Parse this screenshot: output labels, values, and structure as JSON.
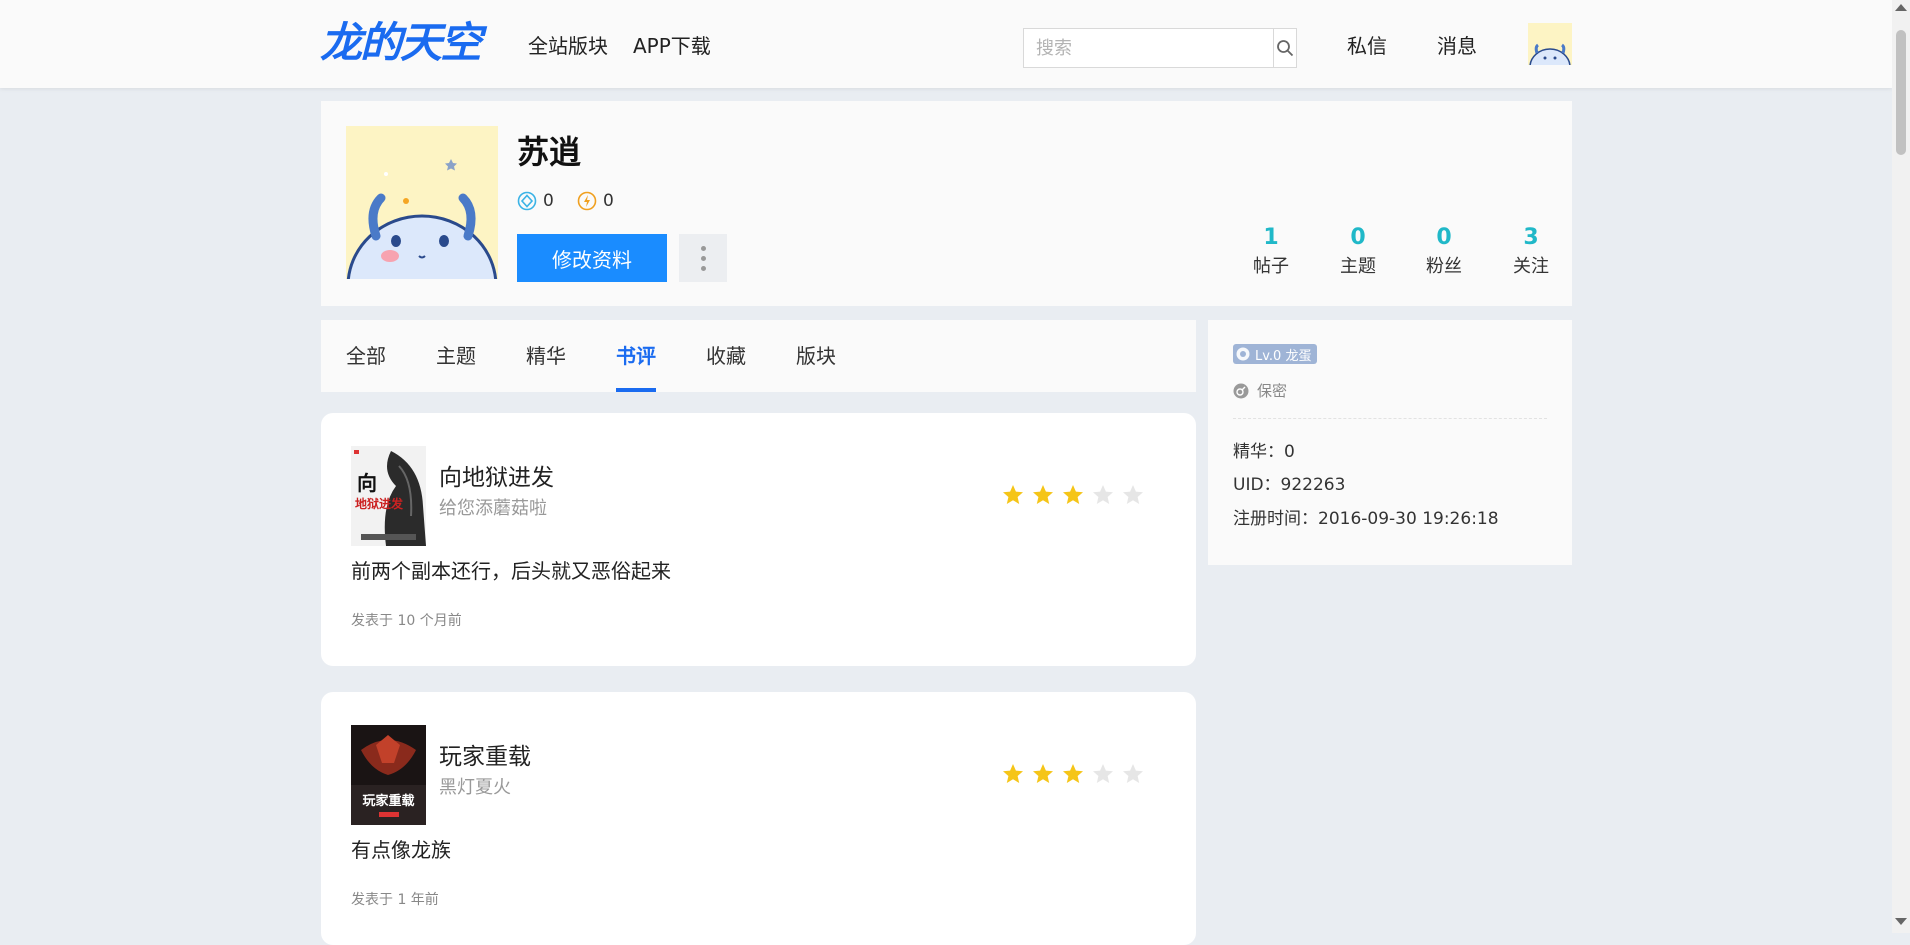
{
  "header": {
    "logo": "龙的天空",
    "nav": [
      "全站版块",
      "APP下载"
    ],
    "search_placeholder": "搜索",
    "actions": [
      "私信",
      "消息"
    ]
  },
  "profile": {
    "name": "苏逍",
    "currency1": "0",
    "currency2": "0",
    "edit_label": "修改资料",
    "stats": [
      {
        "value": "1",
        "label": "帖子"
      },
      {
        "value": "0",
        "label": "主题"
      },
      {
        "value": "0",
        "label": "粉丝"
      },
      {
        "value": "3",
        "label": "关注"
      }
    ]
  },
  "tabs": [
    "全部",
    "主题",
    "精华",
    "书评",
    "收藏",
    "版块"
  ],
  "active_tab": "书评",
  "reviews": [
    {
      "title": "向地狱进发",
      "author": "给您添蘑菇啦",
      "rating": 3,
      "max_rating": 5,
      "text": "前两个副本还行，后头就又恶俗起来",
      "time": "发表于 10 个月前",
      "cover_text": "地狱进发"
    },
    {
      "title": "玩家重载",
      "author": "黑灯夏火",
      "rating": 3,
      "max_rating": 5,
      "text": "有点像龙族",
      "time": "发表于 1 年前",
      "cover_text": "玩家重载"
    }
  ],
  "side": {
    "level": "Lv.0 龙蛋",
    "gender": "保密",
    "essence": "精华：0",
    "uid": "UID：922263",
    "register": "注册时间：2016-09-30 19:26:18"
  },
  "colors": {
    "accent": "#1a6bf0",
    "button": "#1a8cff",
    "stat": "#20b8c8",
    "star_on": "#f5c518",
    "star_off": "#e6e6e6"
  }
}
